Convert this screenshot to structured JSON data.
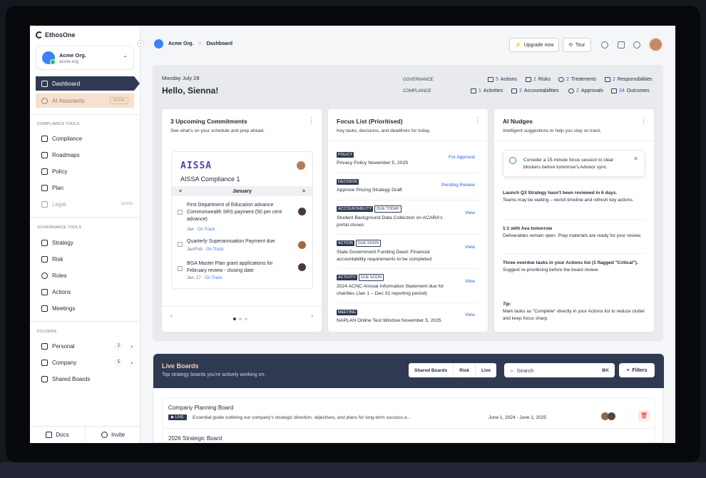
{
  "app": {
    "name": "EthosOne"
  },
  "org": {
    "name": "Acme Org.",
    "domain": "acme.org"
  },
  "sidebar": {
    "dashboard": "Dashboard",
    "ai_assistants": "AI Assistants",
    "soon": "SOON",
    "compliance_tools_label": "COMPLIANCE TOOLS",
    "compliance_tools": [
      "Compliance",
      "Roadmaps",
      "Policy",
      "Plan",
      "Legal"
    ],
    "governance_tools_label": "GOVERNANCE TOOLS",
    "governance_tools": [
      "Strategy",
      "Risk",
      "Roles",
      "Actions",
      "Meetings"
    ],
    "folders_label": "FOLDERS",
    "folders": [
      {
        "label": "Personal",
        "count": "2"
      },
      {
        "label": "Company",
        "count": "5"
      },
      {
        "label": "Shared Boards",
        "count": ""
      }
    ],
    "footer": {
      "docs": "Docs",
      "invite": "Invite"
    }
  },
  "topbar": {
    "breadcrumb_org": "Acme Org.",
    "breadcrumb_sep": ">",
    "breadcrumb_page": "Dashboard",
    "upgrade": "Upgrade now",
    "tour": "Tour"
  },
  "overview": {
    "date": "Monday July 28",
    "greeting": "Hello, Sienna!",
    "governance_label": "GOVERNANCE",
    "compliance_label": "COMPLIANCE",
    "governance": [
      {
        "n": "5",
        "l": "Actions"
      },
      {
        "n": "2",
        "l": "Risks"
      },
      {
        "n": "2",
        "l": "Treatments"
      },
      {
        "n": "2",
        "l": "Responsibilities"
      }
    ],
    "compliance": [
      {
        "n": "1",
        "l": "Activities"
      },
      {
        "n": "2",
        "l": "Accountabilities"
      },
      {
        "n": "2",
        "l": "Approvals"
      },
      {
        "n": "34",
        "l": "Outcomes"
      }
    ]
  },
  "commitments": {
    "title": "3 Upcoming Commitments",
    "subtitle": "See what's on your schedule and prep ahead.",
    "logo_text": "AISSA",
    "card_title": "AISSA Compliance 1",
    "month": "January",
    "prev": "<",
    "next": ">",
    "tasks": [
      {
        "title": "First Department of Education advance Commonwealth SRS payment (50 per cent advance)",
        "date": "Jan",
        "status": "On Track"
      },
      {
        "title": "Quarterly Superannuation Payment due.",
        "date": "Jan/Feb",
        "status": "On Track"
      },
      {
        "title": "BGA Master Plan grant applications for February review - closing date",
        "date": "Jan. 17",
        "status": "On Track"
      }
    ]
  },
  "focus": {
    "title": "Focus List (Prioritised)",
    "subtitle": "Key tasks, decisions, and deadlines for today.",
    "items": [
      {
        "tags": [
          "POLICY"
        ],
        "outline": [],
        "text": "Privacy Policy     November 5, 2025",
        "action": "For Approval"
      },
      {
        "tags": [
          "DECISION"
        ],
        "outline": [],
        "text": "Approve Pricing Strategy Draft",
        "action": "Pending Review"
      },
      {
        "tags": [
          "ACCOUNTABILITY"
        ],
        "outline": [
          "DUE TODAY"
        ],
        "text": "Student Background Data Collection on ACARA's portal closes",
        "action": "View"
      },
      {
        "tags": [
          "ACTION"
        ],
        "outline": [
          "DUE SOON"
        ],
        "text": "State Government Funding Deed: Financial accountability requirements to be completed",
        "action": "View"
      },
      {
        "tags": [
          "ACTIVITY"
        ],
        "outline": [
          "DUE SOON"
        ],
        "text": "2024 ACNC Annual Information Statement due for charities (Jan 1 – Dec 31 reporting period)",
        "action": "View"
      },
      {
        "tags": [
          "MEETING"
        ],
        "outline": [],
        "text": "NAPLAN Online Test Window     November 5, 2025",
        "action": "View"
      }
    ]
  },
  "nudges": {
    "title": "AI Nudges",
    "subtitle": "Intelligent suggestions to help you stay on track.",
    "toast": "Consider a 15-minute focus session to clear blockers before tomorrow's Advisor sync.",
    "items": [
      {
        "bold": "Launch Q3 Strategy hasn't been reviewed in 6 days.",
        "text": "Teams may be waiting – revisit timeline and refresh key actions."
      },
      {
        "bold": "1:1 with Ava tomorrow",
        "text": "Deliverables remain open. Prep materials are ready for your review."
      },
      {
        "bold": "Three overdue tasks in your Actions list (1 flagged \"Critical\").",
        "text": "Suggest re-prioritising before the board review."
      }
    ],
    "tip_label": "Tip:",
    "tip": "Mark tasks as \"Complete\" directly in your Actions list to reduce clutter and keep focus sharp."
  },
  "live_boards": {
    "title": "Live Boards",
    "subtitle": "Top strategy boards you're actively working on.",
    "segments": [
      "Shared Boards",
      "Risk",
      "Live"
    ],
    "search_placeholder": "Search",
    "shortcut": "⌘K",
    "filters": "Filters",
    "rows": [
      {
        "title": "Company Planning Board",
        "badge": "▶ LIVE",
        "desc": "Essential guide outlining our company's strategic direction, objectives, and plans for long-term success a...",
        "dates": "June 1, 2024 - June 1, 2025"
      },
      {
        "title": "2026 Strategic Board",
        "badge": "",
        "desc": "",
        "dates": ""
      }
    ]
  }
}
